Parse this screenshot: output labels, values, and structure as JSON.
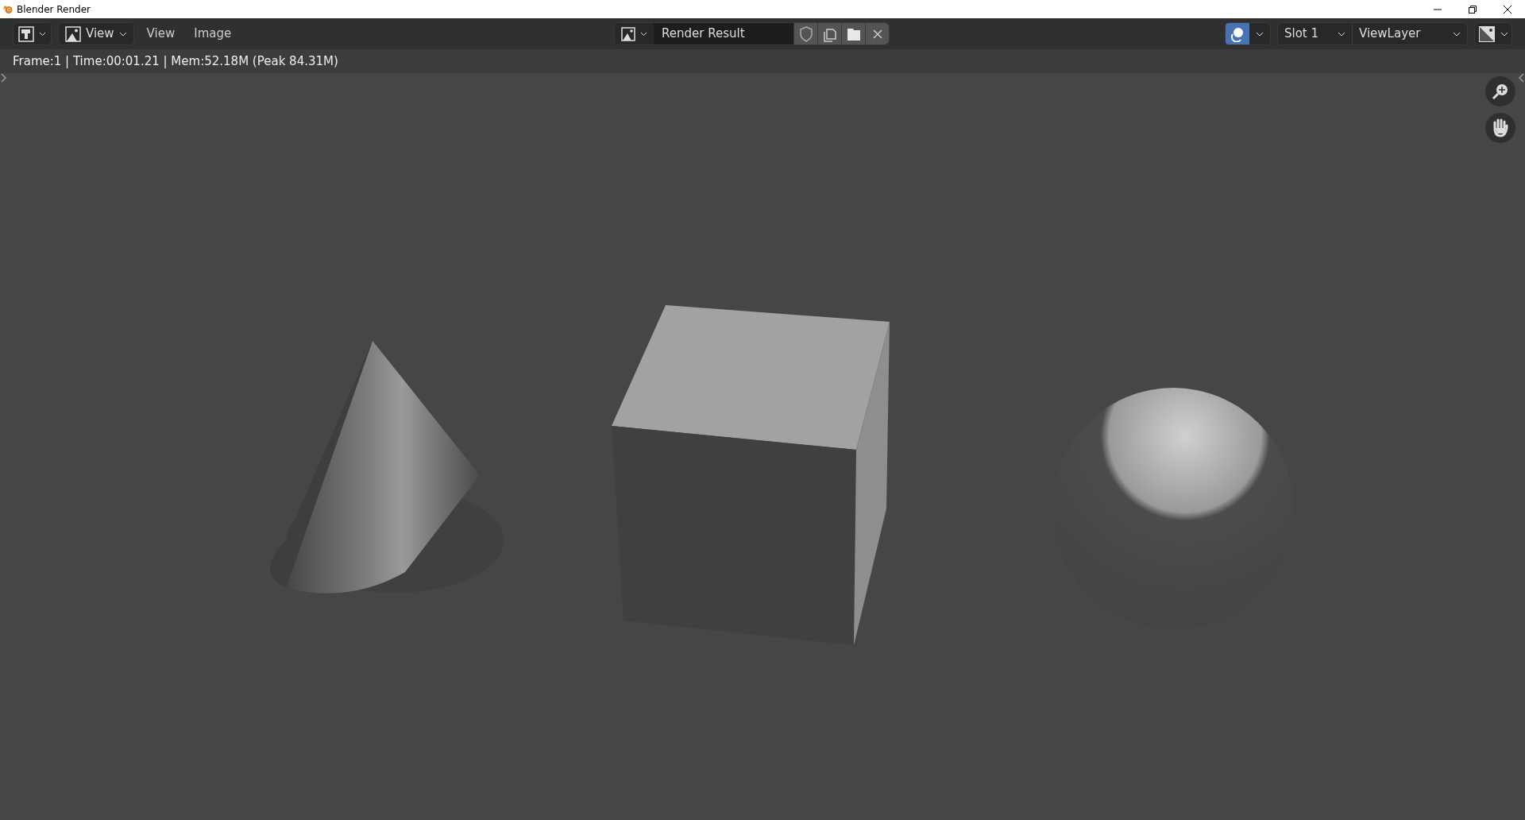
{
  "window": {
    "title": "Blender Render"
  },
  "header": {
    "left_menus": [
      {
        "kind": "dropdown",
        "label": "View"
      },
      {
        "kind": "menu",
        "label": "View"
      },
      {
        "kind": "menu",
        "label": "Image"
      }
    ],
    "image_name": "Render Result",
    "overlay_toggle": {
      "on": true
    },
    "slot": "Slot 1",
    "view_layer": "ViewLayer"
  },
  "info": "Frame:1 | Time:00:01.21 | Mem:52.18M (Peak 84.31M)"
}
